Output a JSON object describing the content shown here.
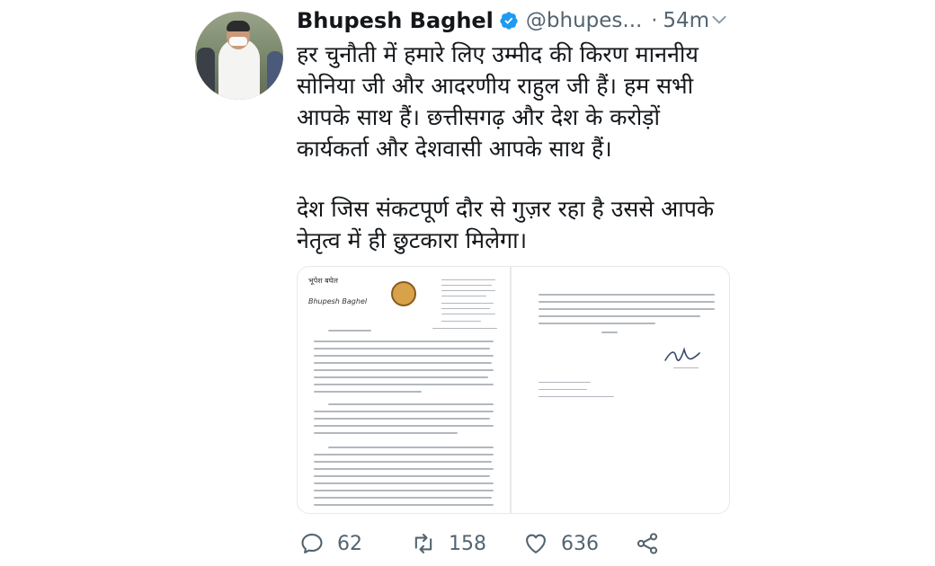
{
  "tweet": {
    "display_name": "Bhupesh Baghel",
    "handle": "@bhupes...",
    "separator": "·",
    "time": "54m",
    "paragraph_1": [
      "हर चुनौती में हमारे लिए उम्मीद की किरण माननीय",
      "सोनिया जी और आदरणीय राहुल जी हैं। हम सभी",
      "आपके साथ हैं। छत्तीसगढ़ और देश के करोड़ों",
      "कार्यकर्ता और देशवासी आपके साथ हैं।"
    ],
    "paragraph_2": [
      "देश जिस संकटपूर्ण दौर से गुज़र रहा है उससे आपके",
      "नेतृत्व में ही छुटकारा मिलेगा।"
    ]
  },
  "attachment": {
    "page_1_from": "भूपेश बघेल",
    "page_1_name": "Bhupesh Baghel"
  },
  "actions": {
    "reply_count": "62",
    "retweet_count": "158",
    "like_count": "636"
  },
  "colors": {
    "verified": "#1d9bf0",
    "secondary_text": "#536471",
    "primary_text": "#14171a"
  },
  "icons": [
    "verified-badge-icon",
    "chevron-down-icon",
    "reply-icon",
    "retweet-icon",
    "like-icon",
    "share-icon"
  ]
}
